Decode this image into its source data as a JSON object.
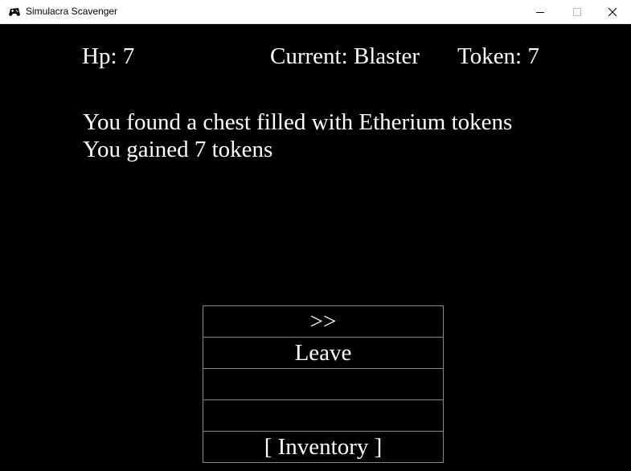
{
  "window": {
    "title": "Simulacra Scavenger"
  },
  "hud": {
    "hp": "Hp: 7",
    "current": "Current: Blaster",
    "token": "Token: 7"
  },
  "messages": [
    "You found a chest filled with Etherium tokens",
    "You gained 7 tokens"
  ],
  "menu": [
    ">>",
    "Leave",
    "",
    "",
    "[ Inventory ]"
  ],
  "icons": {
    "app": "game-controller-icon",
    "minimize": "minimize-icon",
    "maximize": "maximize-icon",
    "close": "close-icon"
  }
}
